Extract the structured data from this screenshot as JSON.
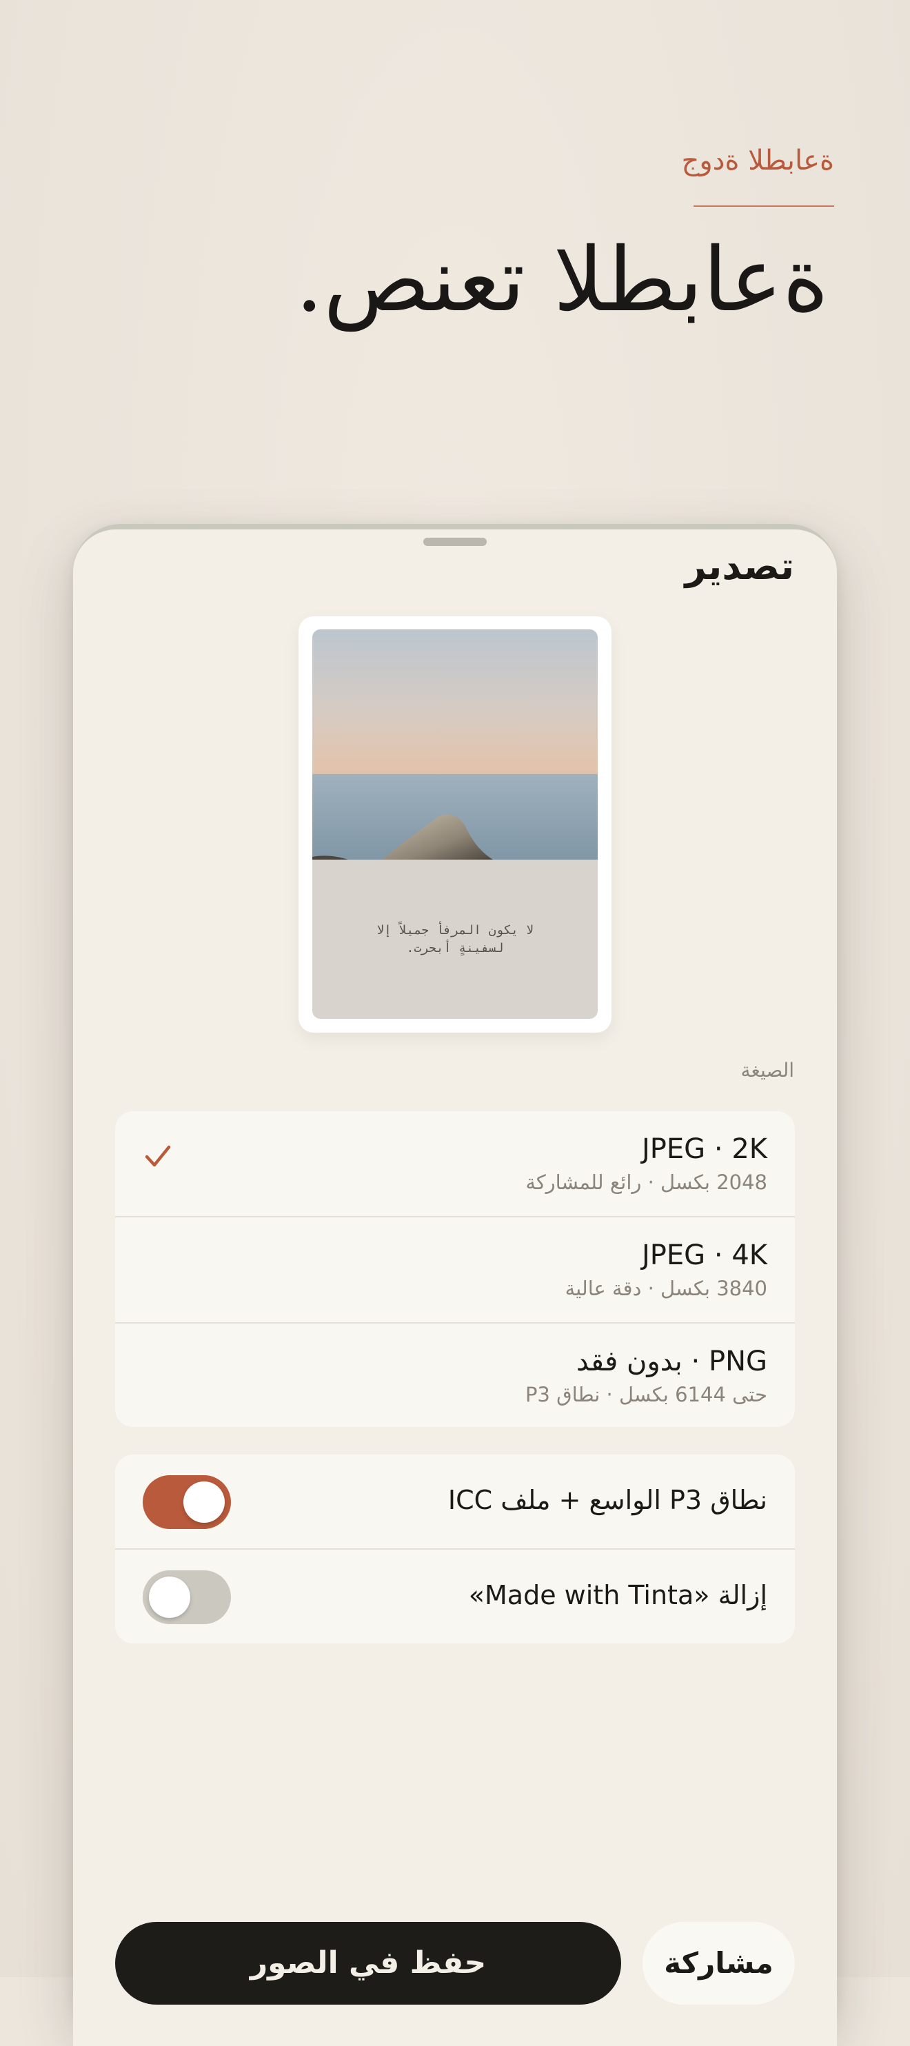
{
  "header": {
    "eyebrow": "ةعابطلا ةدوج",
    "headline": "ةعابطلا تعنص."
  },
  "sheet": {
    "title": "تصدير"
  },
  "preview": {
    "caption_line1": "لا يكون المرفأ جميلاً إلا",
    "caption_line2": "لسفينةٍ أبحرت."
  },
  "format": {
    "section_label": "الصيغة",
    "options": [
      {
        "title": "JPEG · 2K",
        "subtitle": "2048 بكسل · رائع للمشاركة",
        "selected": true
      },
      {
        "title": "JPEG · 4K",
        "subtitle": "3840 بكسل · دقة عالية",
        "selected": false
      },
      {
        "title": "PNG · بدون فقد",
        "subtitle": "حتى 6144 بكسل · نطاق P3",
        "selected": false
      }
    ]
  },
  "toggles": [
    {
      "label": "نطاق P3 الواسع + ملف ICC",
      "on": true
    },
    {
      "label": "إزالة «Made with Tinta»",
      "on": false
    }
  ],
  "actions": {
    "primary_label": "حفظ في الصور",
    "secondary_label": "مشاركة"
  },
  "colors": {
    "accent": "#b85a3b",
    "background": "#ece6dd",
    "sheet": "#f3efe6",
    "primary_button": "#1e1c19"
  },
  "icons": {
    "selected_mark": "checkmark-icon"
  }
}
